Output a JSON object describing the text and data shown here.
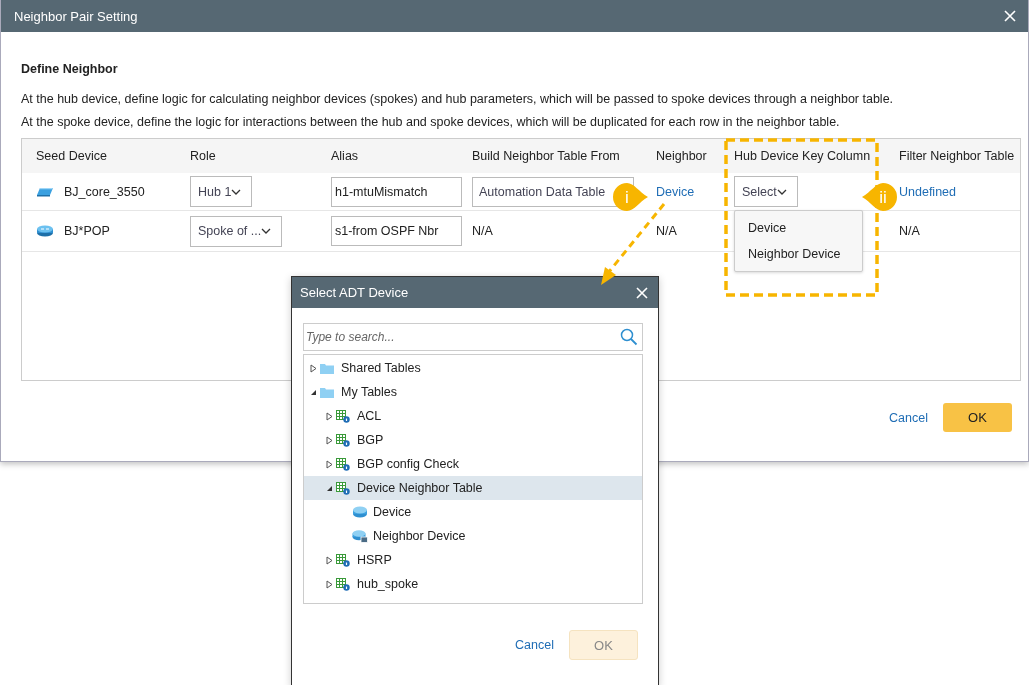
{
  "dialog": {
    "title": "Neighbor Pair Setting",
    "heading": "Define Neighbor",
    "descriptions": [
      "At the hub device, define logic for calculating neighbor devices (spokes) and hub parameters, which will be passed to spoke devices through a neighbor table.",
      "At the spoke device, define the logic for interactions between the hub and spoke devices, which will be duplicated for each row in the neighbor table."
    ],
    "table": {
      "columns": [
        "Seed Device",
        "Role",
        "Alias",
        "Build Neighbor Table From",
        "Neighbor",
        "Hub Device Key Column",
        "Filter Neighbor Table"
      ],
      "rows": [
        {
          "cells": [
            {
              "kind": "switch-device",
              "text": "BJ_core_3550"
            },
            {
              "kind": "select",
              "text": "Hub 1"
            },
            {
              "kind": "input",
              "text": "h1-mtuMismatch"
            },
            {
              "kind": "box",
              "text": "Automation Data Table"
            },
            {
              "kind": "link",
              "text": "Device"
            },
            {
              "kind": "select",
              "text": "Select",
              "open": true,
              "options": [
                "Device",
                "Neighbor Device"
              ]
            },
            {
              "kind": "link",
              "text": "Undefined"
            }
          ]
        },
        {
          "cells": [
            {
              "kind": "router-device",
              "text": "BJ*POP"
            },
            {
              "kind": "select",
              "text": "Spoke of ..."
            },
            {
              "kind": "input",
              "text": "s1-from OSPF Nbr"
            },
            {
              "kind": "text",
              "text": "N/A"
            },
            {
              "kind": "text",
              "text": "N/A"
            },
            {
              "kind": "text",
              "text": ""
            },
            {
              "kind": "text",
              "text": "N/A"
            }
          ]
        }
      ]
    },
    "cancel": "Cancel",
    "ok": {
      "label": "OK",
      "disabled": false
    }
  },
  "adt_dialog": {
    "title": "Select ADT Device",
    "search": {
      "placeholder": "Type to search..."
    },
    "tree": [
      {
        "kind": "folder",
        "label": "Shared Tables",
        "expanded": false,
        "selected": false
      },
      {
        "kind": "folder",
        "label": "My Tables",
        "expanded": true,
        "selected": false,
        "children": [
          {
            "kind": "table",
            "label": "ACL",
            "expanded": false,
            "selected": false
          },
          {
            "kind": "table",
            "label": "BGP",
            "expanded": false,
            "selected": false
          },
          {
            "kind": "table",
            "label": "BGP config Check",
            "expanded": false,
            "selected": false
          },
          {
            "kind": "table",
            "label": "Device Neighbor Table",
            "expanded": true,
            "selected": true,
            "children": [
              {
                "kind": "device",
                "label": "Device",
                "selected": false
              },
              {
                "kind": "neighbor-device",
                "label": "Neighbor Device",
                "selected": false
              }
            ]
          },
          {
            "kind": "table",
            "label": "HSRP",
            "expanded": false,
            "selected": false
          },
          {
            "kind": "table",
            "label": "hub_spoke",
            "expanded": false,
            "selected": false
          }
        ]
      }
    ],
    "cancel": "Cancel",
    "ok": {
      "label": "OK",
      "disabled": true
    }
  },
  "callouts": [
    {
      "label": "i"
    },
    {
      "label": "ii"
    }
  ]
}
